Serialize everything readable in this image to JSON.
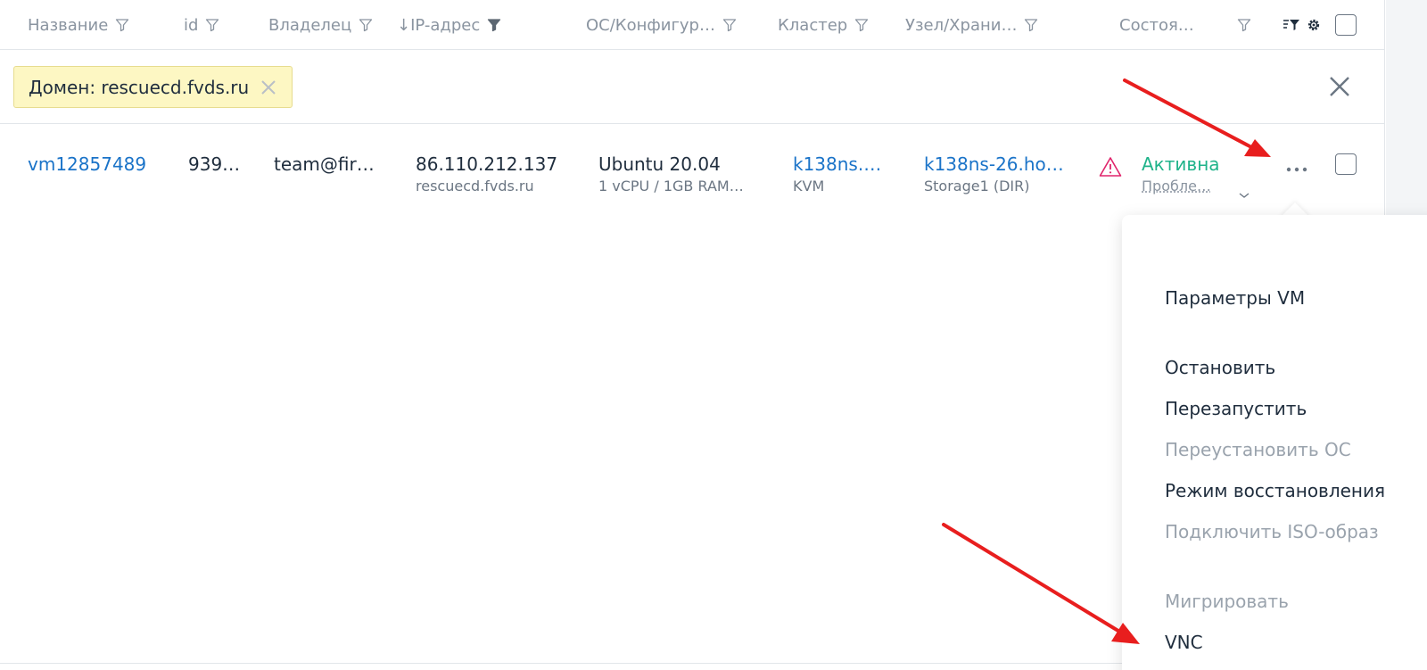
{
  "columns": [
    {
      "label": "Название"
    },
    {
      "label": "id"
    },
    {
      "label": "Владелец"
    },
    {
      "label": "↓IP-адрес"
    },
    {
      "label": "ОС/Конфигур…"
    },
    {
      "label": "Кластер"
    },
    {
      "label": "Узел/Храни…"
    },
    {
      "label": "Состоя…"
    }
  ],
  "filter_chip": {
    "label": "Домен: rescuecd.fvds.ru"
  },
  "row": {
    "name": "vm12857489",
    "id": "939…",
    "owner": "team@fir…",
    "ip": "86.110.212.137",
    "domain": "rescuecd.fvds.ru",
    "os": "Ubuntu 20.04",
    "config": "1 vCPU / 1GB RAM…",
    "cluster": "k138ns.…",
    "cluster_type": "KVM",
    "node": "k138ns-26.ho…",
    "storage": "Storage1 (DIR)",
    "state": "Активна",
    "state_sub": "Пробле…"
  },
  "menu": {
    "items": [
      {
        "label": "Параметры VM",
        "disabled": false
      },
      {
        "label": "Остановить",
        "disabled": false
      },
      {
        "label": "Перезапустить",
        "disabled": false
      },
      {
        "label": "Переустановить ОС",
        "disabled": true
      },
      {
        "label": "Режим восстановления",
        "disabled": false
      },
      {
        "label": "Подключить ISO-образ",
        "disabled": true
      },
      {
        "label": "Мигрировать",
        "disabled": true
      },
      {
        "label": "VNC",
        "disabled": false
      }
    ]
  },
  "colors": {
    "link": "#1a73c8",
    "active_state": "#1fb38a",
    "warning_icon": "#e0246b",
    "chip_bg": "#fdf7c3",
    "annotation_arrow": "#e81e1e"
  },
  "icons": {
    "filter": "filter-icon",
    "sort_filter": "sort-filter-icon",
    "settings": "gear-icon",
    "warning": "warning-icon",
    "more": "more-dots-icon",
    "close": "close-icon",
    "chevron": "chevron-down-icon"
  }
}
